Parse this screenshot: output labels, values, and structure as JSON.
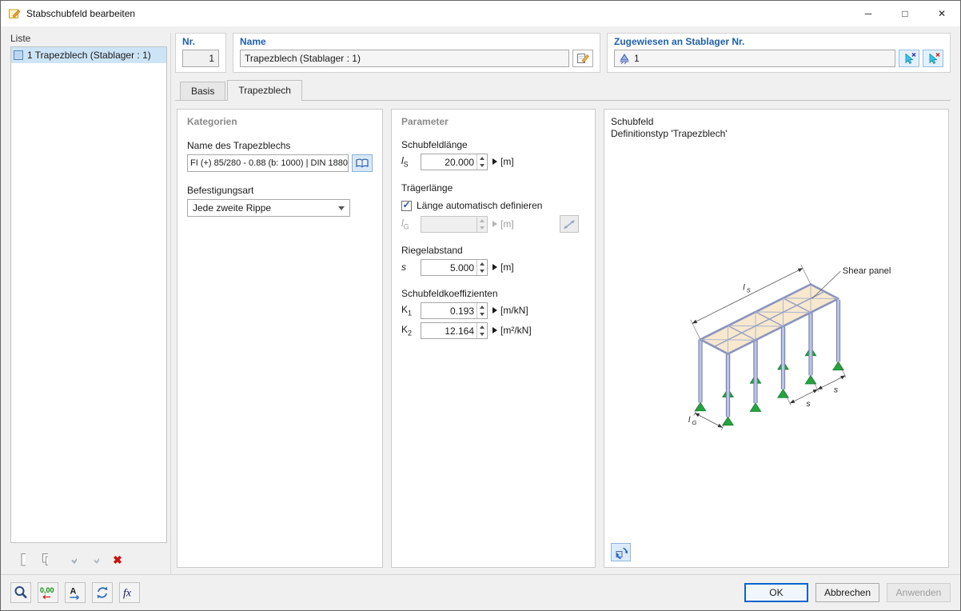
{
  "window": {
    "title": "Stabschubfeld bearbeiten",
    "minimize": "─",
    "maximize": "□",
    "close": "✕"
  },
  "liste": {
    "header": "Liste",
    "items": [
      {
        "label": "1 Trapezblech (Stablager : 1)"
      }
    ]
  },
  "header": {
    "nr_label": "Nr.",
    "nr_value": "1",
    "name_label": "Name",
    "name_value": "Trapezblech (Stablager : 1)",
    "assigned_label": "Zugewiesen an Stablager Nr.",
    "assigned_value": "1"
  },
  "tabs": [
    {
      "label": "Basis"
    },
    {
      "label": "Trapezblech"
    }
  ],
  "kategorien": {
    "header": "Kategorien",
    "name_label": "Name des Trapezblechs",
    "name_value": "FI (+) 85/280 - 0.88 (b: 1000) | DIN 1880",
    "fastening_label": "Befestigungsart",
    "fastening_value": "Jede zweite Rippe"
  },
  "parameter": {
    "header": "Parameter",
    "schubfeldlaenge_label": "Schubfeldlänge",
    "ls": {
      "base": "l",
      "sub": "S",
      "value": "20.000",
      "unit": "[m]"
    },
    "traegerlaenge_label": "Trägerlänge",
    "auto_label": "Länge automatisch definieren",
    "lg": {
      "base": "l",
      "sub": "G",
      "value": "",
      "unit": "[m]"
    },
    "riegelabstand_label": "Riegelabstand",
    "s": {
      "base": "s",
      "sub": "",
      "value": "5.000",
      "unit": "[m]"
    },
    "koeff_label": "Schubfeldkoeffizienten",
    "k1": {
      "base": "K",
      "sub": "1",
      "value": "0.193",
      "unit": "[m/kN]"
    },
    "k2": {
      "base": "K",
      "sub": "2",
      "value": "12.164",
      "unit": "[m²/kN]"
    }
  },
  "preview": {
    "line1": "Schubfeld",
    "line2": "Definitionstyp 'Trapezblech'",
    "labels": {
      "shear_panel": "Shear panel",
      "l": "l",
      "ls_sub": "S",
      "lg_sub": "G",
      "s": "s"
    }
  },
  "footer": {
    "ok": "OK",
    "cancel": "Abbrechen",
    "apply": "Anwenden",
    "decimal_icon": "0,00",
    "a_icon": "A",
    "fx_icon": "fx"
  },
  "icons": {
    "check": "✓",
    "delete": "✖"
  }
}
